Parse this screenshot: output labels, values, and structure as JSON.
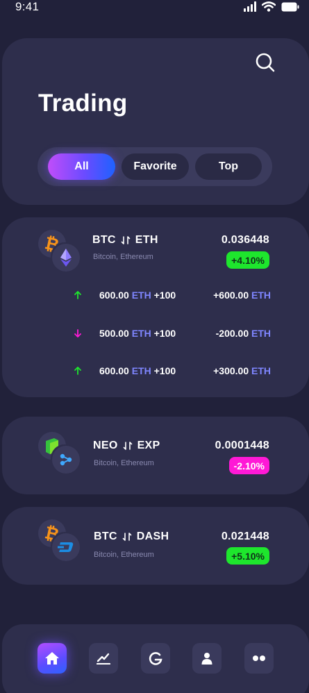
{
  "status_bar": {
    "time": "9:41"
  },
  "header": {
    "title": "Trading",
    "tabs": [
      {
        "label": "All",
        "active": true
      },
      {
        "label": "Favorite",
        "active": false
      },
      {
        "label": "Top",
        "active": false
      }
    ]
  },
  "pairs": [
    {
      "base": "BTC",
      "quote": "ETH",
      "sub": "Bitcoin, Ethereum",
      "price": "0.036448",
      "change": "+4.10%",
      "trend": "up",
      "transactions": [
        {
          "direction": "up",
          "amount": "600.00",
          "unit": "ETH",
          "extra": "+100",
          "change": "+600.00",
          "change_unit": "ETH"
        },
        {
          "direction": "down",
          "amount": "500.00",
          "unit": "ETH",
          "extra": "+100",
          "change": "-200.00",
          "change_unit": "ETH"
        },
        {
          "direction": "up",
          "amount": "600.00",
          "unit": "ETH",
          "extra": "+100",
          "change": "+300.00",
          "change_unit": "ETH"
        }
      ]
    },
    {
      "base": "NEO",
      "quote": "EXP",
      "sub": "Bitcoin, Ethereum",
      "price": "0.0001448",
      "change": "-2.10%",
      "trend": "down"
    },
    {
      "base": "BTC",
      "quote": "DASH",
      "sub": "Bitcoin, Ethereum",
      "price": "0.021448",
      "change": "+5.10%",
      "trend": "up"
    }
  ],
  "colors": {
    "background": "#21213a",
    "card": "#2e2e4c",
    "up": "#1ee62d",
    "down": "#ff19d6",
    "accent": "#7f86ff"
  },
  "nav": [
    {
      "icon": "home-icon",
      "active": true
    },
    {
      "icon": "chart-icon",
      "active": false
    },
    {
      "icon": "exchange-icon",
      "active": false
    },
    {
      "icon": "user-icon",
      "active": false
    },
    {
      "icon": "more-icon",
      "active": false
    }
  ]
}
